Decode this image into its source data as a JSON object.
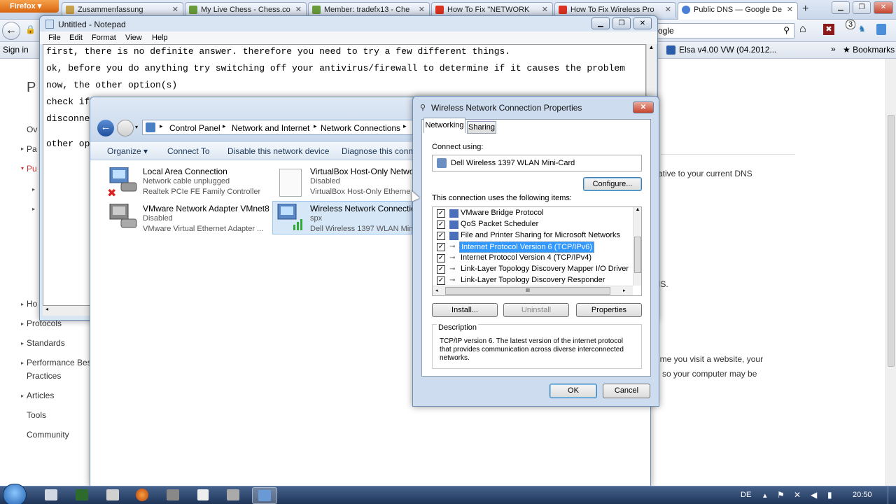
{
  "browser": {
    "menu_label": "Firefox",
    "tabs": [
      {
        "label": "Zusammenfassung",
        "color": "#c8a24a"
      },
      {
        "label": "My Live Chess - Chess.co",
        "color": "#6a9c3a"
      },
      {
        "label": "Member: tradefx13 - Che",
        "color": "#6a9c3a"
      },
      {
        "label": "How To Fix \"NETWORK",
        "color": "#d32"
      },
      {
        "label": "How To Fix Wireless Pro",
        "color": "#d32"
      },
      {
        "label": "Public DNS — Google De",
        "color": "#4a7fd8"
      }
    ],
    "new_tab": "+",
    "search_value": "ogle",
    "badge_count": "3",
    "sign_in": "Sign in",
    "bookmark_elsa": "Elsa v4.00 VW (04.2012...",
    "bookmarks_label": "Bookmarks",
    "chevron": "»"
  },
  "webpage": {
    "heading_partial": "P",
    "sidebar": [
      "Ov",
      "Pa",
      "Pu"
    ],
    "sidebar_lower": [
      "Ho",
      "Protocols",
      "Standards",
      "Performance Best",
      "Practices",
      "Articles",
      "Tools",
      "Community"
    ],
    "right_text1": "ative to your current DNS",
    "right_text2": "IS.",
    "right_text3": "ime you visit a website, your",
    "right_text4": "so your computer may be"
  },
  "notepad": {
    "title": "Untitled - Notepad",
    "menu": [
      "File",
      "Edit",
      "Format",
      "View",
      "Help"
    ],
    "lines": [
      "first, there is no definite answer. therefore you need to try a few different things.",
      "ok, before you do anything try switching off your antivirus/firewall to determine if it causes the problem",
      "now, the other option(s)",
      "check if",
      "disconne",
      "",
      "other opt"
    ]
  },
  "network": {
    "breadcrumb": [
      "Control Panel",
      "Network and Internet",
      "Network Connections"
    ],
    "toolbar": [
      "Organize",
      "Connect To",
      "Disable this network device",
      "Diagnose this conne"
    ],
    "adapters": [
      {
        "name": "Local Area Connection",
        "status": "Network cable unplugged",
        "device": "Realtek PCIe FE Family Controller"
      },
      {
        "name": "VirtualBox Host-Only Network",
        "status": "Disabled",
        "device": "VirtualBox Host-Only Etherne"
      },
      {
        "name": "VMware Network Adapter VMnet8",
        "status": "Disabled",
        "device": "VMware Virtual Ethernet Adapter ..."
      },
      {
        "name": "Wireless Network Connection",
        "status": "spx",
        "device": "Dell Wireless 1397 WLAN Mini"
      }
    ]
  },
  "dialog": {
    "title": "Wireless Network Connection Properties",
    "tabs": [
      "Networking",
      "Sharing"
    ],
    "connect_using_label": "Connect using:",
    "adapter": "Dell Wireless 1397 WLAN Mini-Card",
    "configure": "Configure...",
    "items_label": "This connection uses the following items:",
    "items": [
      "VMware Bridge Protocol",
      "QoS Packet Scheduler",
      "File and Printer Sharing for Microsoft Networks",
      "Internet Protocol Version 6 (TCP/IPv6)",
      "Internet Protocol Version 4 (TCP/IPv4)",
      "Link-Layer Topology Discovery Mapper I/O Driver",
      "Link-Layer Topology Discovery Responder"
    ],
    "selected_index": 3,
    "install": "Install...",
    "uninstall": "Uninstall",
    "properties": "Properties",
    "description_label": "Description",
    "description": "TCP/IP version 6. The latest version of the internet protocol that provides communication across diverse interconnected networks.",
    "ok": "OK",
    "cancel": "Cancel",
    "hscroll_mark": "III"
  },
  "taskbar": {
    "lang": "DE",
    "time": "20:50"
  }
}
